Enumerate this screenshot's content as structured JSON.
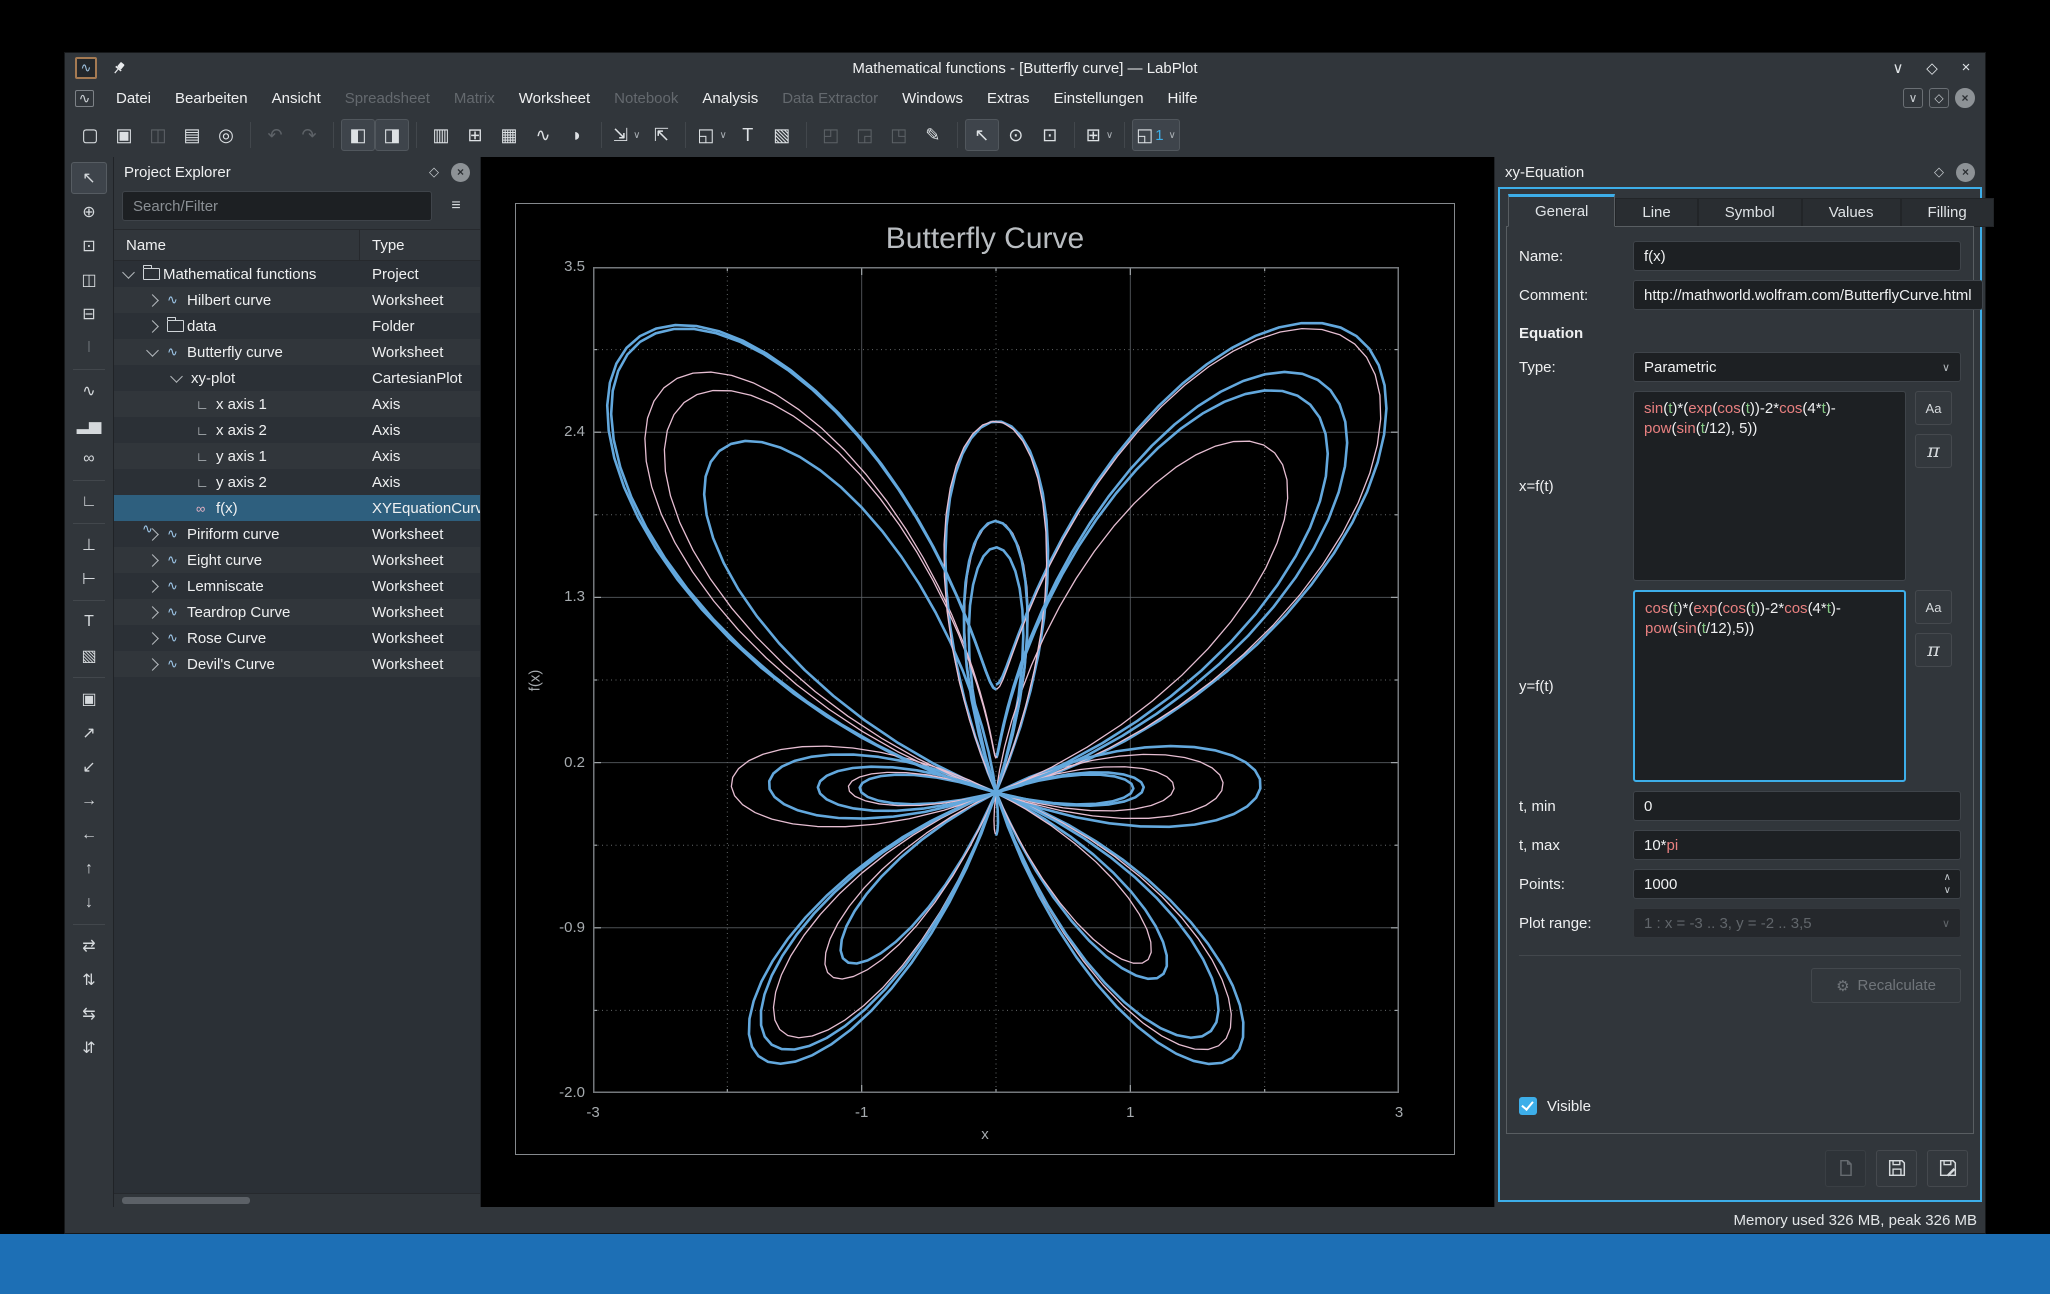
{
  "taskbar": {
    "color": "#1d6fb5"
  },
  "window": {
    "title": "Mathematical functions - [Butterfly curve] — LabPlot",
    "controls": [
      {
        "name": "minimize-button",
        "glyph": "∨"
      },
      {
        "name": "maximize-button",
        "glyph": "◇"
      },
      {
        "name": "close-button",
        "glyph": "×"
      }
    ],
    "mdi_controls": [
      {
        "name": "mdi-minimize-button",
        "glyph": "∨"
      },
      {
        "name": "mdi-restore-button",
        "glyph": "◇"
      },
      {
        "name": "mdi-close-button",
        "glyph": "×",
        "circle": true
      }
    ]
  },
  "menubar": {
    "items": [
      {
        "label": "Datei",
        "enabled": true
      },
      {
        "label": "Bearbeiten",
        "enabled": true
      },
      {
        "label": "Ansicht",
        "enabled": true
      },
      {
        "label": "Spreadsheet",
        "enabled": false
      },
      {
        "label": "Matrix",
        "enabled": false
      },
      {
        "label": "Worksheet",
        "enabled": true
      },
      {
        "label": "Notebook",
        "enabled": false
      },
      {
        "label": "Analysis",
        "enabled": true
      },
      {
        "label": "Data Extractor",
        "enabled": false
      },
      {
        "label": "Windows",
        "enabled": true
      },
      {
        "label": "Extras",
        "enabled": true
      },
      {
        "label": "Einstellungen",
        "enabled": true
      },
      {
        "label": "Hilfe",
        "enabled": true
      }
    ]
  },
  "toolbar": {
    "groups": [
      [
        {
          "name": "new-project",
          "glyph": "▢"
        },
        {
          "name": "open-project",
          "glyph": "▣"
        },
        {
          "name": "save-project",
          "glyph": "◫",
          "state": "disabled"
        },
        {
          "name": "print",
          "glyph": "▤"
        },
        {
          "name": "print-preview",
          "glyph": "◎"
        }
      ],
      [
        {
          "name": "undo",
          "glyph": "↶",
          "state": "disabled"
        },
        {
          "name": "redo",
          "glyph": "↷",
          "state": "disabled"
        }
      ],
      [
        {
          "name": "toggle-project-explorer",
          "glyph": "◧",
          "state": "pressed"
        },
        {
          "name": "toggle-properties-explorer",
          "glyph": "◨",
          "state": "pressed"
        }
      ],
      [
        {
          "name": "new-workbook",
          "glyph": "▥"
        },
        {
          "name": "new-spreadsheet",
          "glyph": "⊞"
        },
        {
          "name": "new-matrix",
          "glyph": "▦"
        },
        {
          "name": "new-worksheet",
          "glyph": "∿"
        },
        {
          "name": "color-maps",
          "glyph": "◗"
        }
      ],
      [
        {
          "name": "export-worksheet",
          "glyph": "⇲",
          "chevron": true
        },
        {
          "name": "print-worksheet",
          "glyph": "⇱"
        }
      ],
      [
        {
          "name": "zoom-fit",
          "glyph": "◱",
          "chevron": true
        },
        {
          "name": "add-text-label",
          "glyph": "T"
        },
        {
          "name": "add-image",
          "glyph": "▧"
        }
      ],
      [
        {
          "name": "layout-vertical",
          "glyph": "◰",
          "state": "disabled"
        },
        {
          "name": "layout-horizontal",
          "glyph": "◲",
          "state": "disabled"
        },
        {
          "name": "layout-grid",
          "glyph": "◳",
          "state": "disabled"
        },
        {
          "name": "edit-layout",
          "glyph": "✎"
        }
      ],
      [
        {
          "name": "pointer-mode",
          "glyph": "↖",
          "state": "pressed"
        },
        {
          "name": "crosshair-mode",
          "glyph": "⊙"
        },
        {
          "name": "selection-mode",
          "glyph": "⊡"
        }
      ],
      [
        {
          "name": "zoom-select-mode",
          "glyph": "⊞",
          "chevron": true
        }
      ],
      [
        {
          "name": "magnification",
          "glyph": "◱",
          "label": "1",
          "state": "pressed",
          "chevron": true
        }
      ]
    ]
  },
  "left_toolbar": {
    "items": [
      {
        "name": "pointer-tool",
        "glyph": "↖",
        "state": "active"
      },
      {
        "name": "crosshair-tool",
        "glyph": "⊕"
      },
      {
        "name": "zoom-select-tool",
        "glyph": "⊡"
      },
      {
        "name": "zoom-x-select-tool",
        "glyph": "◫"
      },
      {
        "name": "zoom-y-select-tool",
        "glyph": "⊟"
      },
      {
        "name": "cursor-tool",
        "glyph": "I",
        "state": "disabled"
      },
      {
        "sep": true
      },
      {
        "name": "add-xy-curve",
        "glyph": "∿"
      },
      {
        "name": "add-histogram",
        "glyph": "▂▅"
      },
      {
        "name": "add-equation-curve",
        "glyph": "∞"
      },
      {
        "sep": true
      },
      {
        "name": "add-axis",
        "glyph": "∟"
      },
      {
        "sep": true
      },
      {
        "name": "add-x-axis",
        "glyph": "⊥"
      },
      {
        "name": "add-y-axis",
        "glyph": "⊢"
      },
      {
        "sep": true
      },
      {
        "name": "add-text-box",
        "glyph": "T"
      },
      {
        "name": "add-image-box",
        "glyph": "▧"
      },
      {
        "sep": true
      },
      {
        "name": "scale-auto",
        "glyph": "▣"
      },
      {
        "name": "zoom-in",
        "glyph": "↗"
      },
      {
        "name": "zoom-out",
        "glyph": "↙"
      },
      {
        "name": "shift-right",
        "glyph": "→"
      },
      {
        "name": "shift-left",
        "glyph": "←"
      },
      {
        "name": "shift-up",
        "glyph": "↑"
      },
      {
        "name": "shift-down",
        "glyph": "↓"
      },
      {
        "sep": true
      },
      {
        "name": "auto-scale-x",
        "glyph": "⇄"
      },
      {
        "name": "auto-scale-y",
        "glyph": "⇅"
      },
      {
        "name": "auto-scale-xy",
        "glyph": "⇆"
      },
      {
        "name": "auto-scale-all",
        "glyph": "⇵"
      }
    ]
  },
  "project_explorer": {
    "title": "Project Explorer",
    "float_icon": "◇",
    "close_icon": "×",
    "search_placeholder": "Search/Filter",
    "filter_icon": "≡",
    "columns": [
      "Name",
      "Type"
    ],
    "rows": [
      {
        "name": "Mathematical functions",
        "type": "Project",
        "depth": 0,
        "expander": "expanded",
        "icon": "folder",
        "selected": false
      },
      {
        "name": "Hilbert curve",
        "type": "Worksheet",
        "depth": 1,
        "expander": "collapsed",
        "icon": "worksheet",
        "selected": false
      },
      {
        "name": "data",
        "type": "Folder",
        "depth": 1,
        "expander": "collapsed",
        "icon": "folder",
        "selected": false
      },
      {
        "name": "Butterfly curve",
        "type": "Worksheet",
        "depth": 1,
        "expander": "expanded",
        "icon": "worksheet",
        "selected": false
      },
      {
        "name": "xy-plot",
        "type": "CartesianPlot",
        "depth": 2,
        "expander": "expanded",
        "icon": "plot",
        "selected": false
      },
      {
        "name": "x axis 1",
        "type": "Axis",
        "depth": 3,
        "expander": null,
        "icon": "axis",
        "selected": false
      },
      {
        "name": "x axis 2",
        "type": "Axis",
        "depth": 3,
        "expander": null,
        "icon": "axis",
        "selected": false
      },
      {
        "name": "y axis 1",
        "type": "Axis",
        "depth": 3,
        "expander": null,
        "icon": "axis",
        "selected": false
      },
      {
        "name": "y axis 2",
        "type": "Axis",
        "depth": 3,
        "expander": null,
        "icon": "axis",
        "selected": false
      },
      {
        "name": "f(x)",
        "type": "XYEquationCurve",
        "depth": 3,
        "expander": null,
        "icon": "curve",
        "selected": true
      },
      {
        "name": "Piriform curve",
        "type": "Worksheet",
        "depth": 1,
        "expander": "collapsed",
        "icon": "worksheet",
        "selected": false
      },
      {
        "name": "Eight curve",
        "type": "Worksheet",
        "depth": 1,
        "expander": "collapsed",
        "icon": "worksheet",
        "selected": false
      },
      {
        "name": "Lemniscate",
        "type": "Worksheet",
        "depth": 1,
        "expander": "collapsed",
        "icon": "worksheet",
        "selected": false
      },
      {
        "name": "Teardrop Curve",
        "type": "Worksheet",
        "depth": 1,
        "expander": "collapsed",
        "icon": "worksheet",
        "selected": false
      },
      {
        "name": "Rose Curve",
        "type": "Worksheet",
        "depth": 1,
        "expander": "collapsed",
        "icon": "worksheet",
        "selected": false
      },
      {
        "name": "Devil's Curve",
        "type": "Worksheet",
        "depth": 1,
        "expander": "collapsed",
        "icon": "worksheet",
        "selected": false
      }
    ]
  },
  "chart_data": {
    "type": "line",
    "title": "Butterfly Curve",
    "xlabel": "x",
    "ylabel": "f(x)",
    "xlim": [
      -3,
      3
    ],
    "ylim": [
      -2,
      3.5
    ],
    "x_ticks": [
      -3,
      -1,
      1,
      3
    ],
    "y_ticks": [
      3.5,
      2.4,
      1.3,
      0.2,
      -0.9,
      -2.0
    ],
    "grid": {
      "major": "solid",
      "minor": "dotted"
    },
    "legend": false,
    "background": "#000000",
    "series": [
      {
        "name": "f(x)",
        "kind": "parametric",
        "x_equation": "sin(t)*(exp(cos(t))-2*cos(4*t)-pow(sin(t/12), 5))",
        "y_equation": "cos(t)*(exp(cos(t))-2*cos(4*t)-pow(sin(t/12),5))",
        "t_min": "0",
        "t_max": "10*pi",
        "points": 1000,
        "colors": [
          "#63a8dd",
          "#e6bed2"
        ]
      }
    ]
  },
  "properties": {
    "title": "xy-Equation",
    "float_icon": "◇",
    "close_icon": "×",
    "tabs": [
      "General",
      "Line",
      "Symbol",
      "Values",
      "Filling"
    ],
    "active_tab": "General",
    "fields": {
      "name_label": "Name:",
      "name": "f(x)",
      "comment_label": "Comment:",
      "comment": "http://mathworld.wolfram.com/ButterflyCurve.html",
      "section": "Equation",
      "type_label": "Type:",
      "type": "Parametric",
      "x_label": "x=f(t)",
      "x_equation": "sin(t)*(exp(cos(t))-2*cos(4*t)-pow(sin(t/12), 5))",
      "y_label": "y=f(t)",
      "y_equation": "cos(t)*(exp(cos(t))-2*cos(4*t)-pow(sin(t/12),5))",
      "aa_button": "Aa",
      "pi_button": "π",
      "tmin_label": "t, min",
      "tmin": "0",
      "tmax_label": "t, max",
      "tmax": "10*pi",
      "points_label": "Points:",
      "points": "1000",
      "plot_range_label": "Plot range:",
      "plot_range": "1 : x = -3 .. 3, y = -2 .. 3,5",
      "recalculate_label": "Recalculate",
      "visible_label": "Visible",
      "visible_checked": true
    }
  },
  "statusbar": {
    "memory": "Memory used 326 MB, peak 326 MB"
  }
}
